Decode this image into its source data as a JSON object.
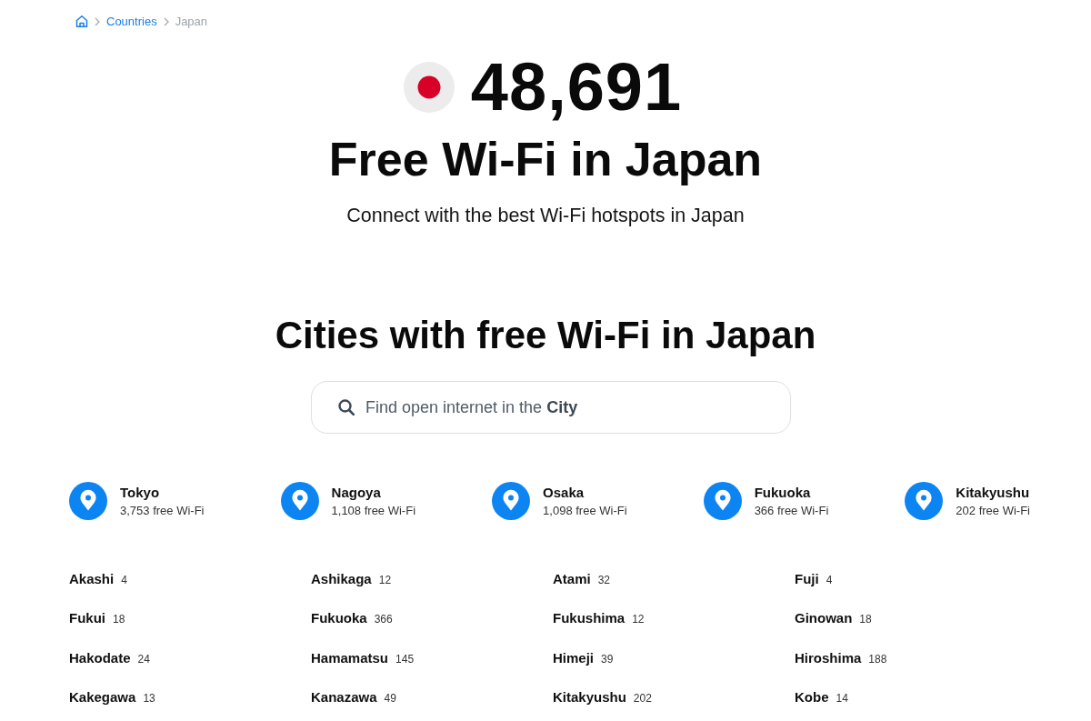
{
  "breadcrumb": [
    {
      "label": "Countries",
      "kind": "link"
    },
    {
      "label": "Japan",
      "kind": "current"
    }
  ],
  "hero": {
    "count": "48,691",
    "title": "Free Wi-Fi in Japan",
    "subtitle": "Connect with the best Wi-Fi hotspots in Japan"
  },
  "cities_section": {
    "title": "Cities with free Wi-Fi in Japan",
    "search": {
      "placeholder": "Find open internet in the **City**"
    },
    "top_cities": [
      {
        "name": "Tokyo",
        "count": "3,753 free Wi-Fi"
      },
      {
        "name": "Nagoya",
        "count": "1,108 free Wi-Fi"
      },
      {
        "name": "Osaka",
        "count": "1,098 free Wi-Fi"
      },
      {
        "name": "Fukuoka",
        "count": "366 free Wi-Fi"
      },
      {
        "name": "Kitakyushu",
        "count": "202 free Wi-Fi"
      }
    ],
    "cities": [
      {
        "name": "Akashi",
        "count": "4"
      },
      {
        "name": "Ashikaga",
        "count": "12"
      },
      {
        "name": "Atami",
        "count": "32"
      },
      {
        "name": "Fuji",
        "count": "4"
      },
      {
        "name": "Fukui",
        "count": "18"
      },
      {
        "name": "Fukuoka",
        "count": "366"
      },
      {
        "name": "Fukushima",
        "count": "12"
      },
      {
        "name": "Ginowan",
        "count": "18"
      },
      {
        "name": "Hakodate",
        "count": "24"
      },
      {
        "name": "Hamamatsu",
        "count": "145"
      },
      {
        "name": "Himeji",
        "count": "39"
      },
      {
        "name": "Hiroshima",
        "count": "188"
      },
      {
        "name": "Kakegawa",
        "count": "13"
      },
      {
        "name": "Kanazawa",
        "count": "49"
      },
      {
        "name": "Kitakyushu",
        "count": "202"
      },
      {
        "name": "Kobe",
        "count": "14"
      }
    ]
  }
}
